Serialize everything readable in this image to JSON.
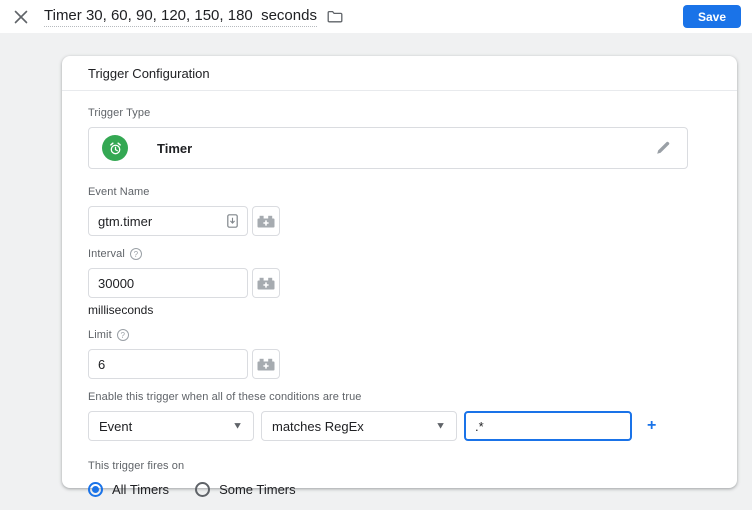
{
  "header": {
    "title": "Timer 30, 60, 90, 120, 150, 180  seconds",
    "save_label": "Save"
  },
  "card": {
    "title": "Trigger Configuration",
    "trigger_type": {
      "label": "Trigger Type",
      "value": "Timer"
    },
    "event_name": {
      "label": "Event Name",
      "value": "gtm.timer"
    },
    "interval": {
      "label": "Interval",
      "value": "30000",
      "unit": "milliseconds"
    },
    "limit": {
      "label": "Limit",
      "value": "6"
    },
    "conditions": {
      "label": "Enable this trigger when all of these conditions are true",
      "variable": "Event",
      "operator": "matches RegEx",
      "value": ".*",
      "add_label": "+"
    },
    "fires_on": {
      "label": "This trigger fires on",
      "options": [
        {
          "label": "All Timers",
          "selected": true
        },
        {
          "label": "Some Timers",
          "selected": false
        }
      ]
    }
  },
  "colors": {
    "accent_blue": "#1a73e8",
    "timer_green": "#34a853"
  }
}
